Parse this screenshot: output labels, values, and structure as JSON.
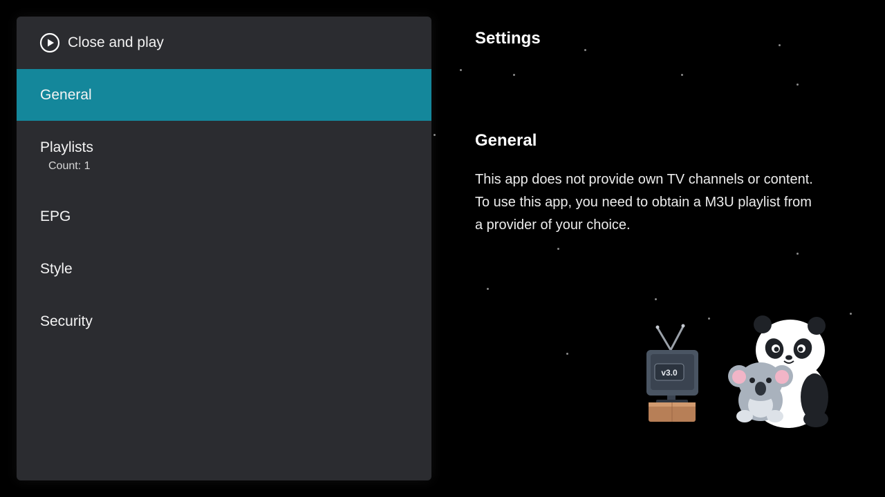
{
  "menu": {
    "close_play_label": "Close and play",
    "items": [
      {
        "label": "General",
        "sub": ""
      },
      {
        "label": "Playlists",
        "sub": "Count: 1"
      },
      {
        "label": "EPG",
        "sub": ""
      },
      {
        "label": "Style",
        "sub": ""
      },
      {
        "label": "Security",
        "sub": ""
      }
    ]
  },
  "content": {
    "title": "Settings",
    "section_title": "General",
    "description": [
      "This app does not provide own TV channels or content.",
      "To use this app, you need to obtain a M3U playlist from",
      "a provider of your choice."
    ],
    "tv_version": "v3.0"
  },
  "colors": {
    "background": "#000000",
    "panel": "#2b2c30",
    "active_item": "#14879b",
    "text": "#ffffff"
  }
}
